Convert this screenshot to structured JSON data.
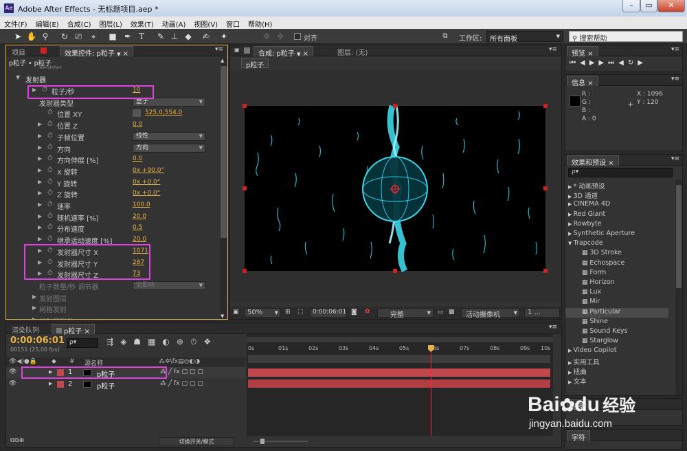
{
  "window": {
    "title": "Adobe After Effects - 无标题项目.aep *",
    "icon": "Ae"
  },
  "menu": [
    "文件(F)",
    "编辑(E)",
    "合成(C)",
    "图层(L)",
    "效果(T)",
    "动画(A)",
    "视图(V)",
    "窗口",
    "帮助(H)"
  ],
  "toolbar": {
    "align_label": "对齐",
    "workspace_label": "工作区:",
    "workspace_value": "所有面板",
    "search_placeholder": "搜索帮助"
  },
  "left_panel": {
    "tabs": [
      "项目",
      "效果控件: p粒子"
    ],
    "breadcrumb": "p粒子 • p粒子",
    "cut_row": "Register",
    "section": "发射器",
    "rows": [
      {
        "label": "粒子/秒",
        "value": "10",
        "type": "val",
        "tri": true,
        "sw": true,
        "indent": 1
      },
      {
        "label": "发射器类型",
        "value": "盒子",
        "type": "dd",
        "tri": false,
        "sw": false,
        "indent": 1
      },
      {
        "label": "位置 XY",
        "value": "525.0,554.0",
        "type": "pos",
        "tri": false,
        "sw": true,
        "indent": 2
      },
      {
        "label": "位置 Z",
        "value": "0.0",
        "type": "val",
        "tri": true,
        "sw": true,
        "indent": 2
      },
      {
        "label": "子帧位置",
        "value": "线性",
        "type": "dd",
        "tri": true,
        "sw": true,
        "indent": 2
      },
      {
        "label": "方向",
        "value": "方向",
        "type": "dd",
        "tri": true,
        "sw": true,
        "indent": 2
      },
      {
        "label": "方向伸展 [%]",
        "value": "0.0",
        "type": "val",
        "tri": true,
        "sw": true,
        "indent": 2
      },
      {
        "label": "X 旋转",
        "value": "0x +90.0°",
        "type": "val",
        "tri": true,
        "sw": true,
        "indent": 2
      },
      {
        "label": "Y 旋转",
        "value": "0x +0.0°",
        "type": "val",
        "tri": true,
        "sw": true,
        "indent": 2
      },
      {
        "label": "Z 旋转",
        "value": "0x +0.0°",
        "type": "val",
        "tri": true,
        "sw": true,
        "indent": 2
      },
      {
        "label": "速率",
        "value": "100.0",
        "type": "val",
        "tri": true,
        "sw": true,
        "indent": 2
      },
      {
        "label": "随机速率 [%]",
        "value": "20.0",
        "type": "val",
        "tri": true,
        "sw": true,
        "indent": 2
      },
      {
        "label": "分布速度",
        "value": "0.5",
        "type": "val",
        "tri": true,
        "sw": true,
        "indent": 2
      },
      {
        "label": "继承运动速度 [%]",
        "value": "20.0",
        "type": "val",
        "tri": true,
        "sw": true,
        "indent": 2
      },
      {
        "label": "发射器尺寸 X",
        "value": "1071",
        "type": "val",
        "tri": true,
        "sw": true,
        "indent": 2
      },
      {
        "label": "发射器尺寸 Y",
        "value": "287",
        "type": "val",
        "tri": true,
        "sw": true,
        "indent": 2
      },
      {
        "label": "发射器尺寸 Z",
        "value": "73",
        "type": "val",
        "tri": true,
        "sw": true,
        "indent": 2
      },
      {
        "label": "粒子数量/秒 调节器",
        "value": "无影响",
        "type": "dddim",
        "tri": false,
        "sw": false,
        "indent": 1
      },
      {
        "label": "发射图层",
        "value": "",
        "type": "dim",
        "tri": true,
        "sw": false,
        "indent": 1
      },
      {
        "label": "网格发射",
        "value": "",
        "type": "dim",
        "tri": true,
        "sw": false,
        "indent": 1
      },
      {
        "label": "发射器附件",
        "value": "",
        "type": "cut",
        "tri": true,
        "sw": false,
        "indent": 1
      }
    ]
  },
  "comp_panel": {
    "tabs": [
      "合成: p粒子",
      "图层: (无)"
    ],
    "comp_chip": "p粒子",
    "zoom": "50%",
    "timecode": "0:00:06:01",
    "quality": "完整",
    "camera": "活动摄像机",
    "views": "1 ..."
  },
  "preview": {
    "tab": "预览"
  },
  "info": {
    "tab": "信息",
    "r": "R :",
    "g": "G :",
    "b": "B :",
    "a": "A : 0",
    "x": "X : 1096",
    "y": "Y : 120"
  },
  "effects": {
    "tab": "效果和预设",
    "search": "ρ▾",
    "items": [
      {
        "label": "* 动画预设",
        "level": 0
      },
      {
        "label": "3D 通道",
        "level": 0
      },
      {
        "label": "CINEMA 4D",
        "level": 0
      },
      {
        "label": "Red Giant",
        "level": 0
      },
      {
        "label": "Rowbyte",
        "level": 0
      },
      {
        "label": "Synthetic Aperture",
        "level": 0
      },
      {
        "label": "Trapcode",
        "level": 0,
        "open": true
      },
      {
        "label": "3D Stroke",
        "level": 1
      },
      {
        "label": "Echospace",
        "level": 1
      },
      {
        "label": "Form",
        "level": 1
      },
      {
        "label": "Horizon",
        "level": 1
      },
      {
        "label": "Lux",
        "level": 1
      },
      {
        "label": "Mir",
        "level": 1
      },
      {
        "label": "Particular",
        "level": 1,
        "sel": true
      },
      {
        "label": "Shine",
        "level": 1
      },
      {
        "label": "Sound Keys",
        "level": 1
      },
      {
        "label": "Starglow",
        "level": 1
      },
      {
        "label": "Video Copilot",
        "level": 0
      },
      {
        "label": "实用工具",
        "level": 0
      },
      {
        "label": "扭曲",
        "level": 0
      },
      {
        "label": "文本",
        "level": 0
      }
    ]
  },
  "bottom_right_tabs": [
    "段落",
    "字符"
  ],
  "timeline": {
    "tabs": [
      "渲染队列",
      "p粒子"
    ],
    "timecode": "0:00:06:01",
    "frames": "00151 (25.00 fps)",
    "col_num": "#",
    "col_name": "源名称",
    "layers": [
      {
        "num": "1",
        "name": "p粒子"
      },
      {
        "num": "2",
        "name": "p粒子"
      }
    ],
    "ruler": [
      "0s",
      "01s",
      "02s",
      "03s",
      "04s",
      "05s",
      "06s",
      "07s",
      "08s",
      "09s",
      "10s"
    ],
    "current_time_s": 6.04,
    "toggle_label": "切换开关/模式"
  },
  "watermark": {
    "brand": "Bai",
    "brand2": "du",
    "brand_cn": "经验",
    "url": "jingyan.baidu.com"
  },
  "colors": {
    "accent": "#e8b34a",
    "highlight": "#e040e0",
    "layer_bar": "#c0474d",
    "playhead": "#e03030"
  }
}
